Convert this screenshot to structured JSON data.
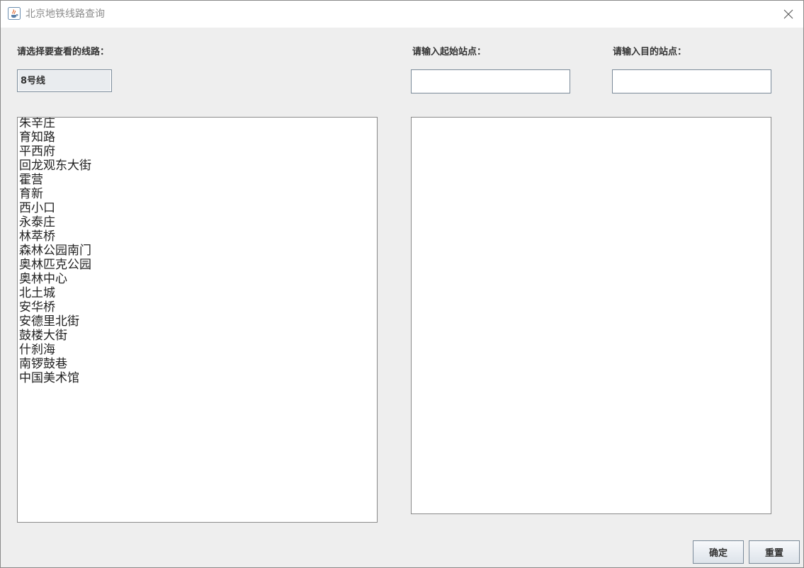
{
  "window": {
    "title": "北京地铁线路查询"
  },
  "line_selector": {
    "label": "请选择要查看的线路：",
    "selected": "8号线"
  },
  "start_station": {
    "label": "请输入起始站点：",
    "value": ""
  },
  "end_station": {
    "label": "请输入目的站点：",
    "value": ""
  },
  "stations": [
    "朱辛庄",
    "育知路",
    "平西府",
    "回龙观东大街",
    "霍营",
    "育新",
    "西小口",
    "永泰庄",
    "林萃桥",
    "森林公园南门",
    "奥林匹克公园",
    "奥林中心",
    "北土城",
    "安华桥",
    "安德里北街",
    "鼓楼大街",
    "什刹海",
    "南锣鼓巷",
    "中国美术馆"
  ],
  "buttons": {
    "confirm": "确定",
    "reset": "重置"
  },
  "icons": {
    "app": "java-coffee-cup-icon",
    "close": "close-x-icon"
  },
  "colors": {
    "background": "#eeeeee",
    "titlebar": "#ffffff",
    "field_border": "#7a8a99"
  }
}
